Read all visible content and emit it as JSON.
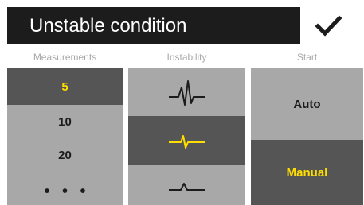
{
  "header": {
    "title": "Unstable condition"
  },
  "icons": {
    "confirm": "checkmark-icon",
    "wave": "pulse-waveform-icon"
  },
  "colors": {
    "header_bg": "#1c1c1c",
    "cell_bg": "#a8a8a8",
    "selected_bg": "#555555",
    "selected_fg": "#ffdd00"
  },
  "columns": {
    "measurements": {
      "label": "Measurements",
      "options": [
        "5",
        "10",
        "20",
        "• • •"
      ],
      "selected": "5"
    },
    "instability": {
      "label": "Instability",
      "options": [
        "high",
        "medium",
        "low"
      ],
      "selected": "medium"
    },
    "start": {
      "label": "Start",
      "options": [
        "Auto",
        "Manual"
      ],
      "selected": "Manual"
    }
  }
}
